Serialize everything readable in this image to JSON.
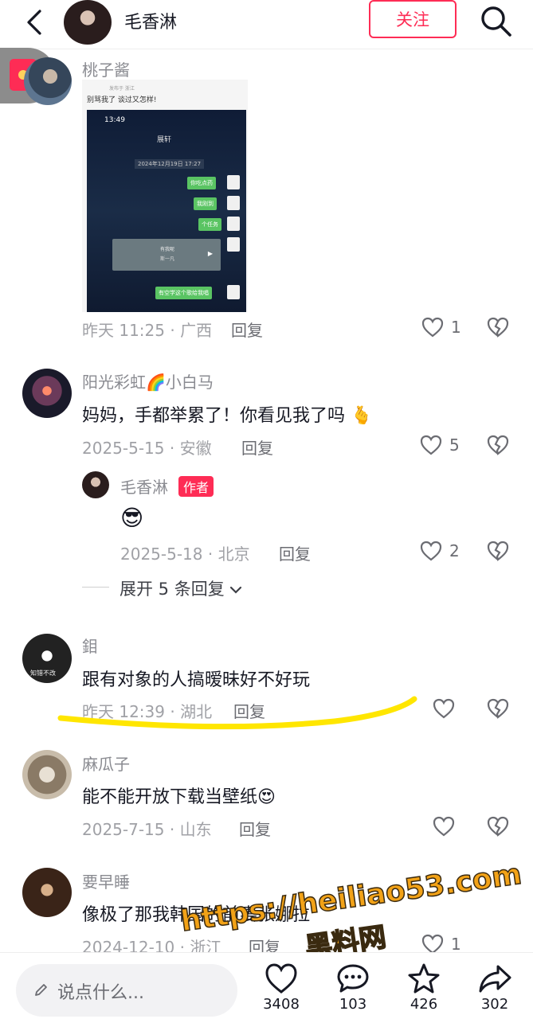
{
  "header": {
    "author_name": "毛香淋",
    "follow_label": "关注"
  },
  "comments": [
    {
      "username": "桃子酱",
      "image": {
        "top_text": "别骂我了 谈过又怎样!",
        "top_sub": "发布于 浙江",
        "status_time": "13:49",
        "chat_title": "展轩",
        "chat_date": "2024年12月19日 17:27",
        "bubbles": [
          "你吃点药",
          "我刚到",
          "个任务",
          "有空学这个歌给我唱"
        ],
        "card_title": "有我呢",
        "card_sub": "斯一凡"
      },
      "meta": "昨天 11:25 · 广西",
      "reply_label": "回复",
      "likes": "1"
    },
    {
      "username": "阳光彩虹🌈小白马",
      "text": "妈妈，手都举累了！你看见我了吗 🫰",
      "meta": "2025-5-15 · 安徽",
      "reply_label": "回复",
      "likes": "5",
      "author_reply": {
        "username": "毛香淋",
        "tag": "作者",
        "text": "😎",
        "meta": "2025-5-18 · 北京",
        "reply_label": "回复",
        "likes": "2"
      },
      "expand_label": "展开 5 条回复"
    },
    {
      "username": "鉬",
      "avatar_text": "知错不改",
      "text": "跟有对象的人搞暧昧好不好玩",
      "meta": "昨天 12:39 · 湖北",
      "reply_label": "回复",
      "likes": ""
    },
    {
      "username": "麻瓜子",
      "text": "能不能开放下载当壁纸😍",
      "meta": "2025-7-15 · 山东",
      "reply_label": "回复",
      "likes": ""
    },
    {
      "username": "要早睡",
      "text": "像极了那我韩国的前妻张娜拉",
      "meta": "2024-12-10 · 浙江",
      "reply_label": "回复",
      "likes": "1"
    }
  ],
  "bottom_bar": {
    "input_placeholder": "说点什么...",
    "like_count": "3408",
    "comment_count": "103",
    "favorite_count": "426",
    "share_count": "302"
  },
  "watermark": {
    "url": "https://heiliao53.com",
    "name": "黑料网"
  },
  "colors": {
    "accent": "#fe2c55",
    "highlight": "#ffe600",
    "watermark": "#f2a217"
  }
}
